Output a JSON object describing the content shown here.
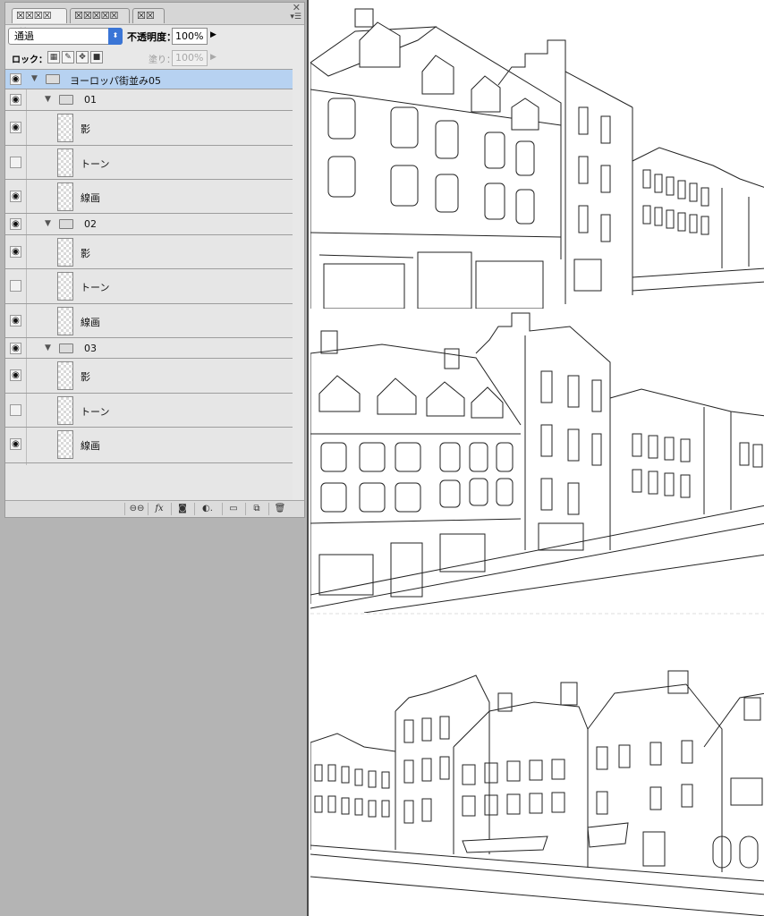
{
  "panel": {
    "tabs": [
      "☒☒☒☒",
      "☒☒☒☒☒",
      "☒☒"
    ],
    "tab_close": "×",
    "blend_mode": "通過",
    "opacity_label": "不透明度：",
    "opacity_value": "100%",
    "lock_label": "ロック：",
    "fill_label": "塗り：",
    "fill_value": "100%",
    "eye_glyph": "◉",
    "layers": [
      {
        "name": "ヨーロッパ街並み05",
        "type": "group",
        "visible": true
      },
      {
        "name": "01",
        "type": "group",
        "visible": true
      },
      {
        "name": "影",
        "type": "layer",
        "visible": true
      },
      {
        "name": "トーン",
        "type": "layer",
        "visible": false
      },
      {
        "name": "線画",
        "type": "layer",
        "visible": true
      },
      {
        "name": "02",
        "type": "group",
        "visible": true
      },
      {
        "name": "影",
        "type": "layer",
        "visible": true
      },
      {
        "name": "トーン",
        "type": "layer",
        "visible": false
      },
      {
        "name": "線画",
        "type": "layer",
        "visible": true
      },
      {
        "name": "03",
        "type": "group",
        "visible": true
      },
      {
        "name": "影",
        "type": "layer",
        "visible": true
      },
      {
        "name": "トーン",
        "type": "layer",
        "visible": false
      },
      {
        "name": "線画",
        "type": "layer",
        "visible": true
      }
    ],
    "footer_icons": [
      "link-icon",
      "fx-icon",
      "mask-icon",
      "adjustment-icon",
      "folder-icon",
      "new-layer-icon",
      "trash-icon"
    ],
    "footer_labels": {
      "link": "⊖⊖",
      "fx": "fx",
      "mask": "◙",
      "adjust": "◐.",
      "folder": "▭",
      "new": "⧉",
      "trash": "🗑"
    }
  },
  "canvas": {
    "background": "#ffffff",
    "line_color": "#222222"
  }
}
